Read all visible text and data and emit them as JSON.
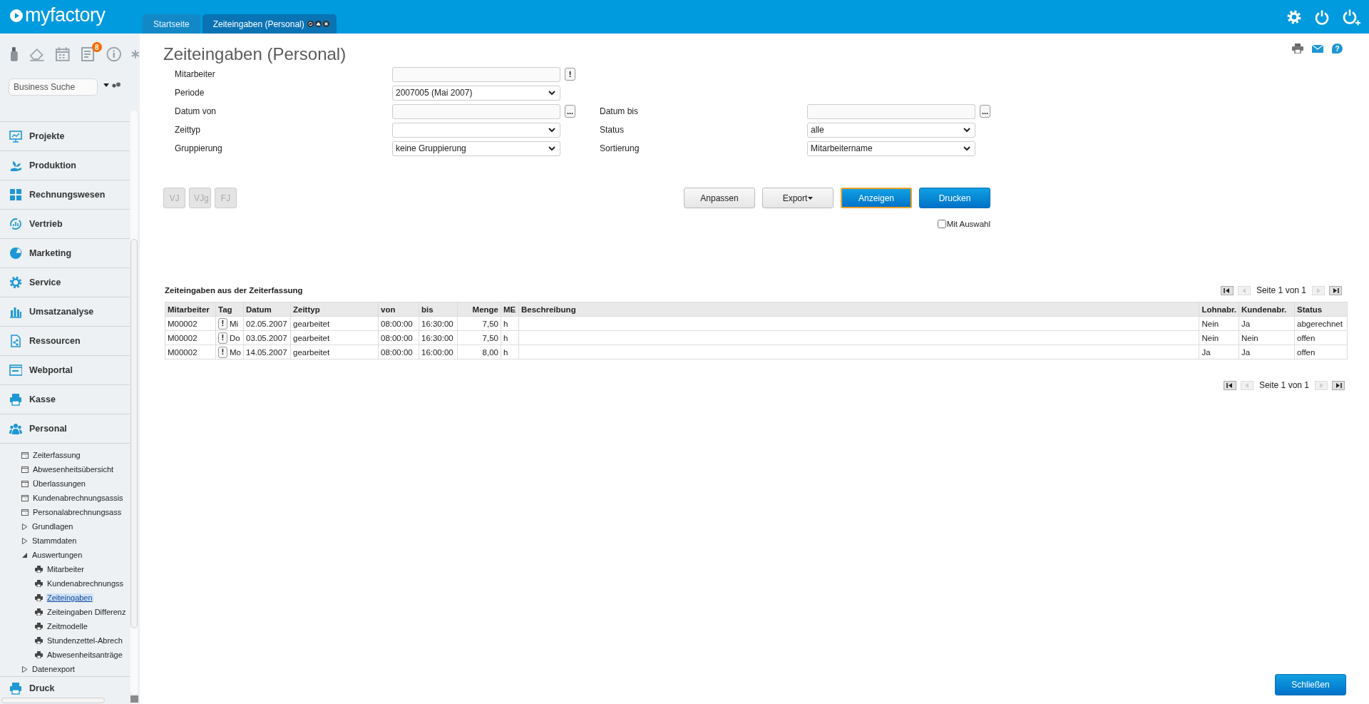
{
  "header": {
    "logo": "myfactory",
    "tabs": [
      {
        "label": "Startseite",
        "selected": false
      },
      {
        "label": "Zeiteingaben (Personal)",
        "selected": true
      }
    ]
  },
  "sidebar": {
    "badge": "8",
    "search": {
      "placeholder": "Business Suche"
    },
    "menu": [
      {
        "label": "Projekte"
      },
      {
        "label": "Produktion"
      },
      {
        "label": "Rechnungswesen"
      },
      {
        "label": "Vertrieb"
      },
      {
        "label": "Marketing"
      },
      {
        "label": "Service"
      },
      {
        "label": "Umsatzanalyse"
      },
      {
        "label": "Ressourcen"
      },
      {
        "label": "Webportal"
      },
      {
        "label": "Kasse"
      },
      {
        "label": "Personal",
        "children": [
          {
            "label": "Zeiterfassung",
            "kind": "page",
            "selected": false
          },
          {
            "label": "Abwesenheitsübersicht",
            "kind": "page",
            "selected": false
          },
          {
            "label": "Überlassungen",
            "kind": "page",
            "selected": false
          },
          {
            "label": "Kundenabrechnungsassis",
            "kind": "page",
            "selected": false
          },
          {
            "label": "Personalabrechnungsass",
            "kind": "page",
            "selected": false
          },
          {
            "label": "Grundlagen",
            "kind": "folder",
            "expanded": false
          },
          {
            "label": "Stammdaten",
            "kind": "folder",
            "expanded": false
          },
          {
            "label": "Auswertungen",
            "kind": "folder",
            "expanded": true,
            "children": [
              {
                "label": "Mitarbeiter",
                "kind": "report",
                "selected": false
              },
              {
                "label": "Kundenabrechnungss",
                "kind": "report",
                "selected": false
              },
              {
                "label": "Zeiteingaben",
                "kind": "report",
                "selected": true
              },
              {
                "label": "Zeiteingaben Differenz",
                "kind": "report",
                "selected": false
              },
              {
                "label": "Zeitmodelle",
                "kind": "report",
                "selected": false
              },
              {
                "label": "Stundenzettel-Abrech",
                "kind": "report",
                "selected": false
              },
              {
                "label": "Abwesenheitsanträge",
                "kind": "report",
                "selected": false
              }
            ]
          },
          {
            "label": "Datenexport",
            "kind": "folder",
            "expanded": false
          }
        ]
      },
      {
        "label": "Druck"
      }
    ]
  },
  "page": {
    "title": "Zeiteingaben (Personal)",
    "help_icon": "?",
    "form": [
      [
        {
          "label": "Mitarbeiter",
          "kind": "text",
          "button": "!"
        }
      ],
      [
        {
          "label": "Periode",
          "kind": "select",
          "value": "2007005 (Mai 2007)"
        }
      ],
      [
        {
          "label": "Datum von",
          "kind": "text",
          "button": "..."
        },
        {
          "label": "Datum bis",
          "kind": "text",
          "button": "..."
        }
      ],
      [
        {
          "label": "Zeittyp",
          "kind": "select"
        },
        {
          "label": "Status",
          "kind": "select",
          "value": "alle"
        }
      ],
      [
        {
          "label": "Gruppierung",
          "kind": "select",
          "value": "keine Gruppierung"
        },
        {
          "label": "Sortierung",
          "kind": "select",
          "value": "Mitarbeitername"
        }
      ]
    ],
    "period_buttons": [
      {
        "label": "VJ",
        "disabled": true
      },
      {
        "label": "VJg",
        "disabled": true
      },
      {
        "label": "FJ",
        "disabled": true
      }
    ],
    "actions": [
      {
        "label": "Anpassen",
        "kind": "default",
        "focused": false
      },
      {
        "label": "Export",
        "kind": "dropdown",
        "focused": false
      },
      {
        "label": "Anzeigen",
        "kind": "primary",
        "focused": true
      },
      {
        "label": "Drucken",
        "kind": "primary",
        "focused": false
      }
    ],
    "option": {
      "label": "Mit Auswahl",
      "checked": false
    },
    "table": {
      "title": "Zeiteingaben aus der Zeiterfassung",
      "pager_top": {
        "label": "Seite 1 von 1",
        "buttons": [
          {
            "kind": "first",
            "disabled": false
          },
          {
            "kind": "prev",
            "disabled": true
          },
          {
            "kind": "next",
            "disabled": true
          },
          {
            "kind": "last",
            "disabled": false
          }
        ]
      },
      "columns": [
        "Mitarbeiter",
        "Tag",
        "Datum",
        "Zeittyp",
        "von",
        "bis",
        "Menge",
        "ME",
        "Beschreibung",
        "Lohnabr.",
        "Kundenabr.",
        "Status"
      ],
      "rows": [
        {
          "cells": [
            "M00002",
            {
              "button": "!",
              "text": "Mi"
            },
            "02.05.2007",
            "gearbeitet",
            "08:00:00",
            "16:30:00",
            "7,50",
            "h",
            null,
            "Nein",
            "Ja",
            "abgerechnet"
          ]
        },
        {
          "cells": [
            "M00002",
            {
              "button": "!",
              "text": "Do"
            },
            "03.05.2007",
            "gearbeitet",
            "08:00:00",
            "16:30:00",
            "7,50",
            "h",
            null,
            "Nein",
            "Nein",
            "offen"
          ]
        },
        {
          "cells": [
            "M00002",
            {
              "button": "!",
              "text": "Mo"
            },
            "14.05.2007",
            "gearbeitet",
            "08:00:00",
            "16:00:00",
            "8,00",
            "h",
            null,
            "Ja",
            "Ja",
            "offen"
          ]
        }
      ],
      "pager_bottom": {
        "label": "Seite 1 von 1",
        "buttons": [
          {
            "kind": "first",
            "disabled": false
          },
          {
            "kind": "prev",
            "disabled": true
          },
          {
            "kind": "next",
            "disabled": true
          },
          {
            "kind": "last",
            "disabled": false
          }
        ]
      }
    },
    "close_button": "Schließen"
  }
}
